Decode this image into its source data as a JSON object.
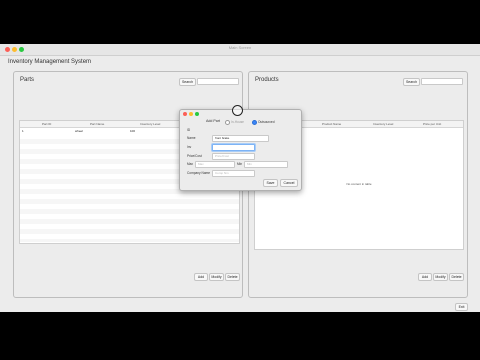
{
  "window": {
    "title": "Main Screen"
  },
  "app": {
    "title": "Inventory Management System"
  },
  "parts": {
    "title": "Parts",
    "search_label": "Search",
    "columns": [
      "Part ID",
      "Part Name",
      "Inventory Level",
      "Price/ Cost per Unit"
    ],
    "rows": [
      {
        "id": "1",
        "name": "wheel",
        "inv": "100",
        "price": "1"
      }
    ],
    "add_label": "Add",
    "modify_label": "Modify",
    "delete_label": "Delete"
  },
  "products": {
    "title": "Products",
    "search_label": "Search",
    "columns": [
      "Product ID",
      "Product Name",
      "Inventory Level",
      "Price per Unit"
    ],
    "empty_text": "No content in table",
    "add_label": "Add",
    "modify_label": "Modify",
    "delete_label": "Delete"
  },
  "exit_label": "Exit",
  "dialog": {
    "title": "Add Part",
    "source_inhouse": "In-House",
    "source_outsourced": "Outsourced",
    "outsourced_selected": true,
    "fields": {
      "id_label": "ID",
      "name_label": "Name",
      "name_value": "front brake",
      "inv_label": "Inv",
      "inv_value": "",
      "price_label": "Price/Cost",
      "price_placeholder": "Price/Cost",
      "max_label": "Max",
      "max_placeholder": "Max",
      "min_label": "Min",
      "min_placeholder": "Min",
      "company_label": "Company Name",
      "company_placeholder": "Comp Nm"
    },
    "save_label": "Save",
    "cancel_label": "Cancel"
  },
  "colors": {
    "accent": "#3b86f7",
    "close": "#fc5f57",
    "minimize": "#fdbc2e",
    "maximize": "#29c940"
  }
}
